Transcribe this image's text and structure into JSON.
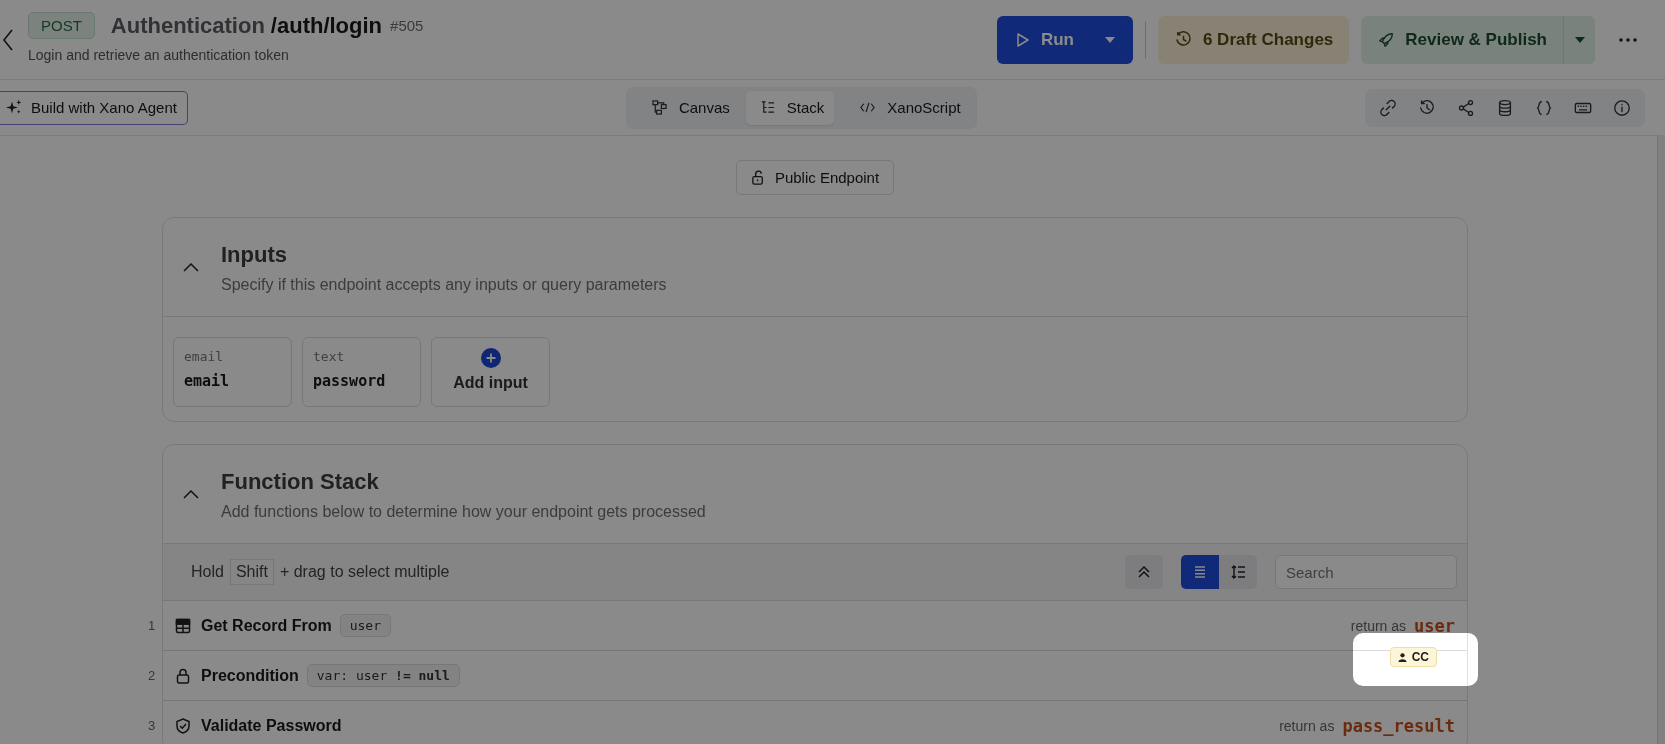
{
  "header": {
    "method": "POST",
    "title": "Authentication",
    "path": "/auth/login",
    "id": "#505",
    "description": "Login and retrieve an authentication token"
  },
  "actions": {
    "run": "Run",
    "drafts": "6 Draft Changes",
    "publish": "Review & Publish"
  },
  "agent_button": "Build with Xano Agent",
  "view_tabs": [
    {
      "label": "Canvas",
      "selected": false
    },
    {
      "label": "Stack",
      "selected": true
    },
    {
      "label": "XanoScript",
      "selected": false
    }
  ],
  "access_button": "Public Endpoint",
  "inputs": {
    "title": "Inputs",
    "subtitle": "Specify if this endpoint accepts any inputs or query parameters",
    "items": [
      {
        "type": "email",
        "name": "email"
      },
      {
        "type": "text",
        "name": "password"
      }
    ],
    "add_label": "Add input"
  },
  "function_stack": {
    "title": "Function Stack",
    "subtitle": "Add functions below to determine how your endpoint gets processed",
    "hint_before": "Hold",
    "hint_key": "Shift",
    "hint_after": "+ drag to select multiple",
    "view_modes": [
      {
        "selected": true
      },
      {
        "selected": false
      }
    ],
    "search": {
      "placeholder": "Search"
    },
    "rows": [
      {
        "number": "1",
        "title": "Get Record From",
        "tag": "user",
        "return_label": "return as",
        "return_var": "user"
      },
      {
        "number": "2",
        "title": "Precondition",
        "tag": "var: user **!= null**",
        "badge": "CC"
      },
      {
        "number": "3",
        "title": "Validate Password",
        "return_label": "return as",
        "return_var": "pass_result"
      }
    ]
  }
}
